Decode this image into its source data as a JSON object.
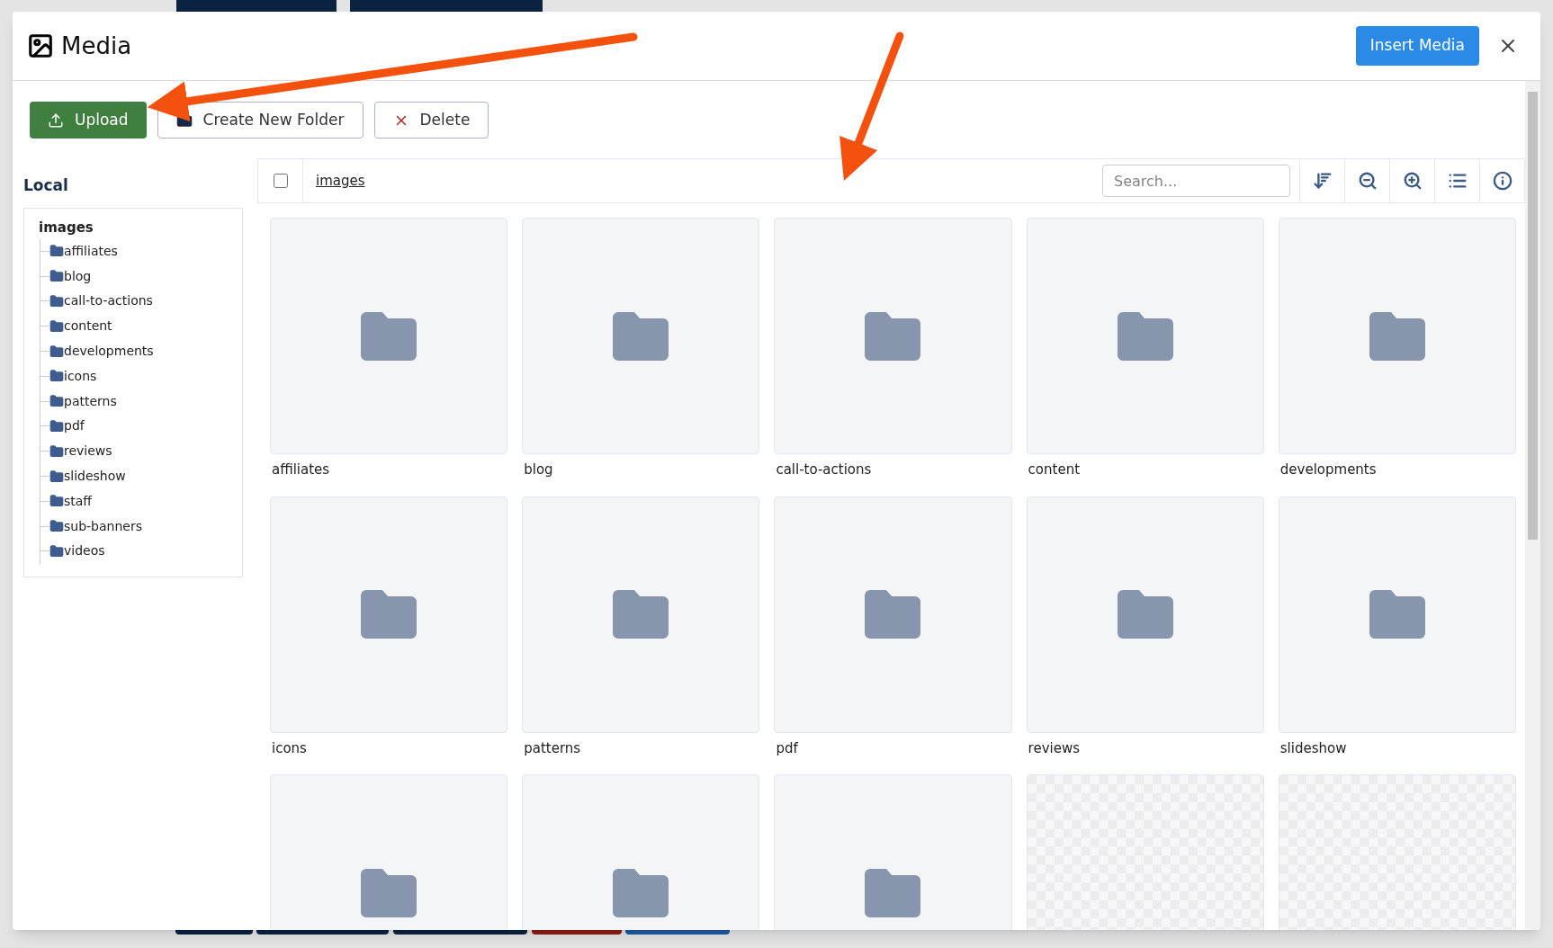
{
  "dialog": {
    "title": "Media",
    "insert_button": "Insert Media"
  },
  "toolbar": {
    "buttons": [
      {
        "kind": "upload",
        "label": "Upload"
      },
      {
        "kind": "folder",
        "label": "Create New Folder"
      },
      {
        "kind": "delete",
        "label": "Delete"
      }
    ]
  },
  "sidebar": {
    "heading": "Local",
    "tree": {
      "label": "images",
      "children": [
        {
          "label": "affiliates"
        },
        {
          "label": "blog"
        },
        {
          "label": "call-to-actions"
        },
        {
          "label": "content"
        },
        {
          "label": "developments"
        },
        {
          "label": "icons"
        },
        {
          "label": "patterns"
        },
        {
          "label": "pdf"
        },
        {
          "label": "reviews"
        },
        {
          "label": "slideshow"
        },
        {
          "label": "staff"
        },
        {
          "label": "sub-banners"
        },
        {
          "label": "videos"
        }
      ]
    }
  },
  "browser": {
    "select_all": {
      "checked": false
    },
    "breadcrumb": "images",
    "search": {
      "placeholder": "Search..."
    },
    "items": [
      {
        "kind": "folder",
        "label": "affiliates"
      },
      {
        "kind": "folder",
        "label": "blog"
      },
      {
        "kind": "folder",
        "label": "call-to-actions"
      },
      {
        "kind": "folder",
        "label": "content"
      },
      {
        "kind": "folder",
        "label": "developments"
      },
      {
        "kind": "folder",
        "label": "icons"
      },
      {
        "kind": "folder",
        "label": "patterns"
      },
      {
        "kind": "folder",
        "label": "pdf"
      },
      {
        "kind": "folder",
        "label": "reviews"
      },
      {
        "kind": "folder",
        "label": "slideshow"
      },
      {
        "kind": "folder"
      },
      {
        "kind": "folder"
      },
      {
        "kind": "folder"
      },
      {
        "kind": "picture"
      },
      {
        "kind": "picture"
      }
    ]
  }
}
